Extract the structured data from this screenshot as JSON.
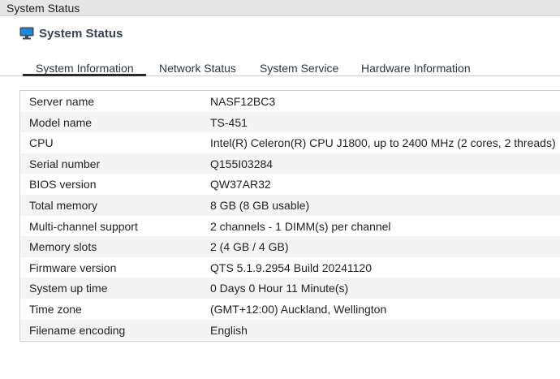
{
  "window": {
    "title": "System Status"
  },
  "header": {
    "title": "System Status",
    "icon": "monitor-icon"
  },
  "tabs": [
    {
      "label": "System Information",
      "active": true
    },
    {
      "label": "Network Status",
      "active": false
    },
    {
      "label": "System Service",
      "active": false
    },
    {
      "label": "Hardware Information",
      "active": false
    }
  ],
  "system_info": [
    {
      "label": "Server name",
      "value": "NASF12BC3"
    },
    {
      "label": "Model name",
      "value": "TS-451"
    },
    {
      "label": "CPU",
      "value": "Intel(R) Celeron(R) CPU J1800, up to 2400 MHz (2 cores, 2 threads)"
    },
    {
      "label": "Serial number",
      "value": "Q155I03284"
    },
    {
      "label": "BIOS version",
      "value": "QW37AR32"
    },
    {
      "label": "Total memory",
      "value": "8 GB (8 GB usable)"
    },
    {
      "label": "Multi-channel support",
      "value": "2 channels - 1 DIMM(s) per channel"
    },
    {
      "label": "Memory slots",
      "value": "2 (4 GB / 4 GB)"
    },
    {
      "label": "Firmware version",
      "value": "QTS 5.1.9.2954 Build 20241120"
    },
    {
      "label": "System up time",
      "value": "0 Days 0 Hour 11 Minute(s)"
    },
    {
      "label": "Time zone",
      "value": "(GMT+12:00) Auckland, Wellington"
    },
    {
      "label": "Filename encoding",
      "value": "English"
    }
  ],
  "colors": {
    "title_text": "#3a4250",
    "row_alt": "#f4f4f4",
    "border": "#cfcfcf",
    "icon_blue": "#1e88d8"
  }
}
